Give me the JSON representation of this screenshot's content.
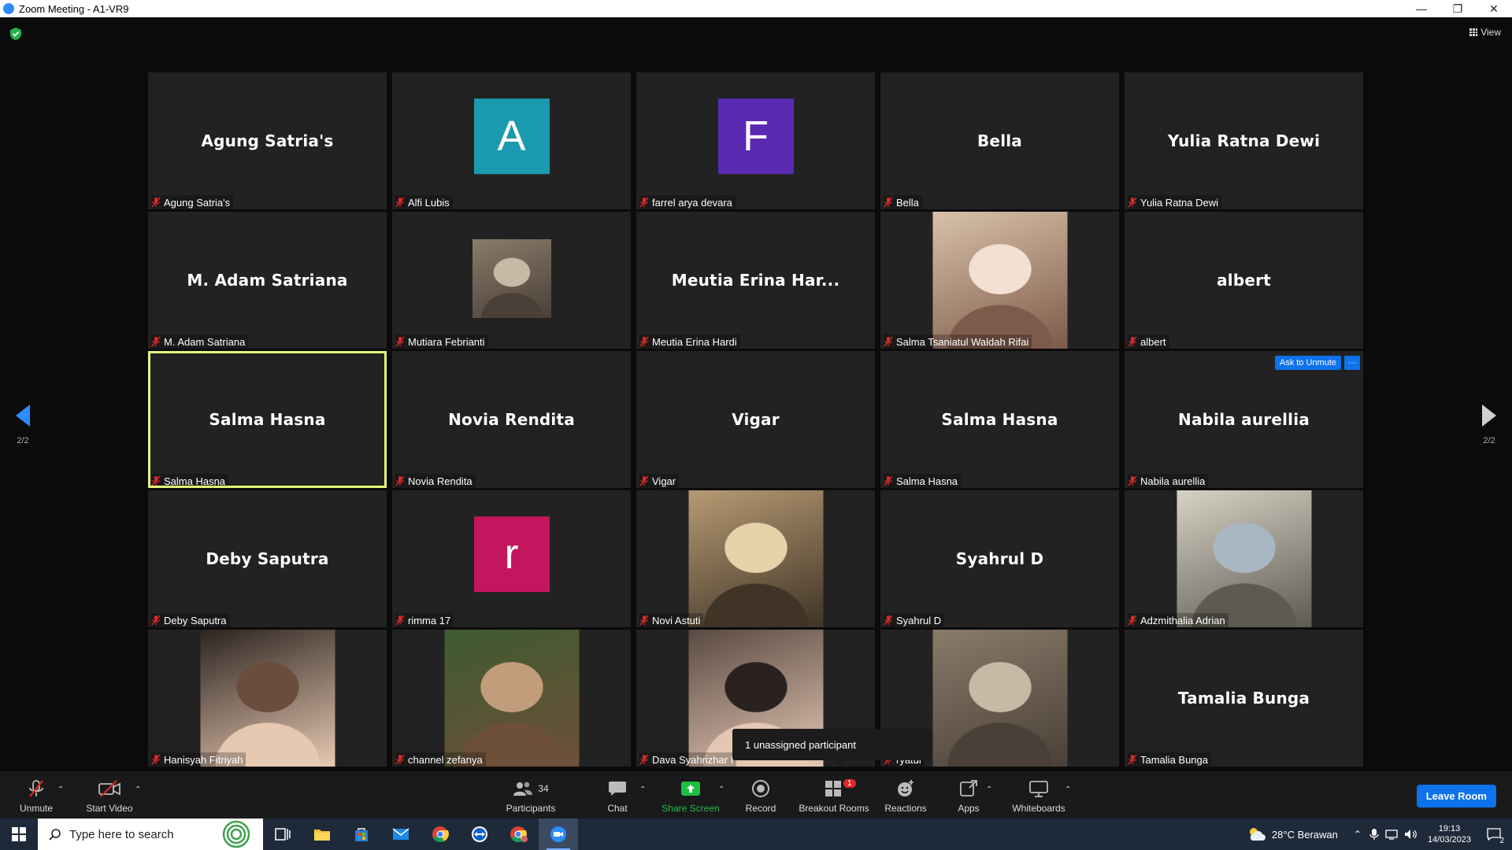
{
  "window": {
    "title": "Zoom Meeting - A1-VR9",
    "controls": [
      "—",
      "❐",
      "✕"
    ]
  },
  "view": {
    "label": "View"
  },
  "pagination": {
    "left": "2/2",
    "right": "2/2"
  },
  "tiles": [
    {
      "kind": "name",
      "center": "Agung Satria's",
      "label": "Agung Satria's"
    },
    {
      "kind": "letter",
      "letter": "A",
      "color": "#1a9aae",
      "label": "Alfi Lubis"
    },
    {
      "kind": "letter",
      "letter": "F",
      "color": "#5b2ab3",
      "label": "farrel arya devara"
    },
    {
      "kind": "name",
      "center": "Bella",
      "label": "Bella"
    },
    {
      "kind": "name",
      "center": "Yulia Ratna Dewi",
      "label": "Yulia Ratna Dewi"
    },
    {
      "kind": "name",
      "center": "M. Adam Satriana",
      "label": "M. Adam Satriana"
    },
    {
      "kind": "photo-small",
      "label": "Mutiara Febrianti"
    },
    {
      "kind": "name",
      "center": "Meutia Erina Har...",
      "label": "Meutia Erina Hardi"
    },
    {
      "kind": "photo",
      "label": "Salma Tsaniatul Waldah Rifai"
    },
    {
      "kind": "name",
      "center": "albert",
      "label": "albert"
    },
    {
      "kind": "name",
      "center": "Salma Hasna",
      "label": "Salma Hasna",
      "active": true
    },
    {
      "kind": "name",
      "center": "Novia Rendita",
      "label": "Novia Rendita"
    },
    {
      "kind": "name",
      "center": "Vigar",
      "label": "Vigar"
    },
    {
      "kind": "name",
      "center": "Salma Hasna",
      "label": "Salma Hasna"
    },
    {
      "kind": "name",
      "center": "Nabila aurellia",
      "label": "Nabila aurellia",
      "hover": true
    },
    {
      "kind": "name",
      "center": "Deby Saputra",
      "label": "Deby Saputra"
    },
    {
      "kind": "letter",
      "letter": "r",
      "color": "#c4165e",
      "label": "rimma 17"
    },
    {
      "kind": "photo",
      "label": "Novi Astuti"
    },
    {
      "kind": "name",
      "center": "Syahrul D",
      "label": "Syahrul D"
    },
    {
      "kind": "photo",
      "label": "Adzmithalia Adrian"
    },
    {
      "kind": "photo",
      "label": "Hanisyah Fitriyah"
    },
    {
      "kind": "photo",
      "label": "channel zefanya"
    },
    {
      "kind": "photo",
      "label": "Dava Syahrizhar I"
    },
    {
      "kind": "photo",
      "label": "ryatul"
    },
    {
      "kind": "name",
      "center": "Tamalia Bunga",
      "label": "Tamalia Bunga"
    }
  ],
  "hover_actions": {
    "ask_unmute": "Ask to Unmute",
    "more": "···"
  },
  "tooltip": {
    "text": "1 unassigned participant"
  },
  "toolbar": {
    "unmute": "Unmute",
    "start_video": "Start Video",
    "participants": "Participants",
    "participants_count": "34",
    "chat": "Chat",
    "share_screen": "Share Screen",
    "record": "Record",
    "breakout_rooms": "Breakout Rooms",
    "breakout_badge": "1",
    "reactions": "Reactions",
    "apps": "Apps",
    "whiteboards": "Whiteboards",
    "leave": "Leave Room"
  },
  "taskbar": {
    "search_placeholder": "Type here to search",
    "weather": "28°C  Berawan",
    "time": "19:13",
    "date": "14/03/2023",
    "notifications": "2"
  },
  "colors": {
    "share_green": "#1fbf44",
    "zoom_blue": "#0e72ed",
    "active_speaker": "#e6f47a",
    "muted_red": "#e02828"
  }
}
